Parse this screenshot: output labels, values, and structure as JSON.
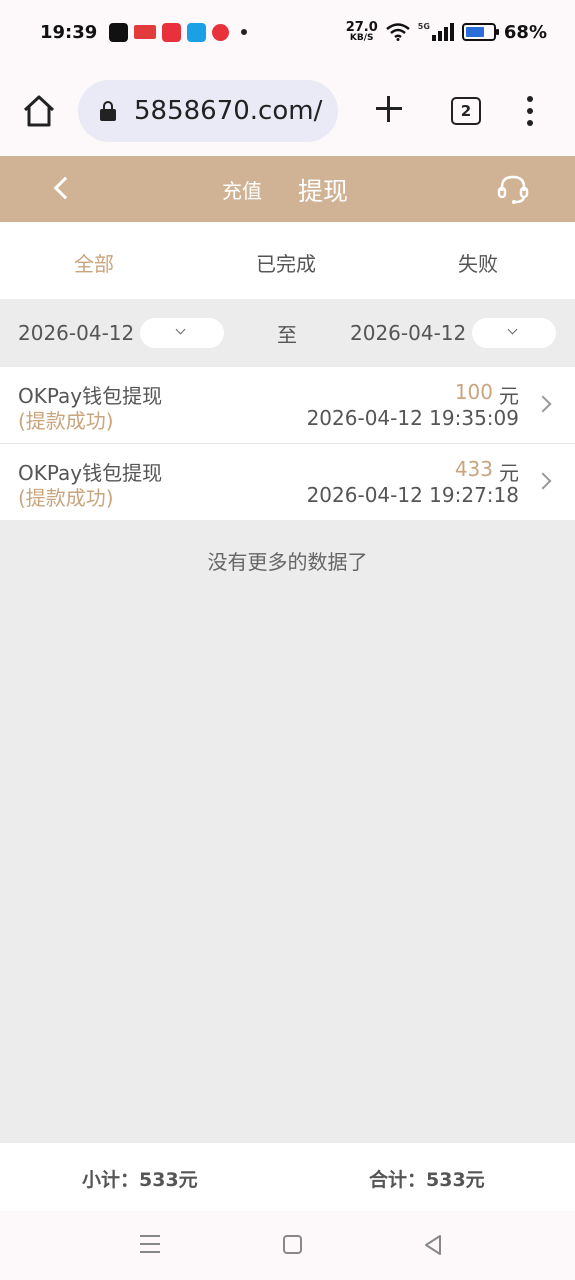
{
  "status_bar": {
    "time": "19:39",
    "net_speed_value": "27.0",
    "net_speed_unit": "KB/S",
    "network_type": "5G",
    "battery_percent": "68%",
    "battery_level": 0.68
  },
  "browser": {
    "url": "5858670.com/",
    "tab_count": "2"
  },
  "header": {
    "tab_recharge": "充值",
    "tab_withdraw": "提现"
  },
  "filters": {
    "all": "全部",
    "completed": "已完成",
    "failed": "失败",
    "active": "all"
  },
  "date_range": {
    "start": "2026-04-12",
    "separator": "至",
    "end": "2026-04-12"
  },
  "records": [
    {
      "title": "OKPay钱包提现",
      "status": "(提款成功)",
      "amount": "100",
      "unit": "元",
      "time": "2026-04-12 19:35:09"
    },
    {
      "title": "OKPay钱包提现",
      "status": "(提款成功)",
      "amount": "433",
      "unit": "元",
      "time": "2026-04-12 19:27:18"
    }
  ],
  "no_more_text": "没有更多的数据了",
  "footer": {
    "subtotal": "小计：533元",
    "total": "合计：533元"
  },
  "colors": {
    "header_bg": "#d0b395",
    "accent": "#c8a57d"
  }
}
